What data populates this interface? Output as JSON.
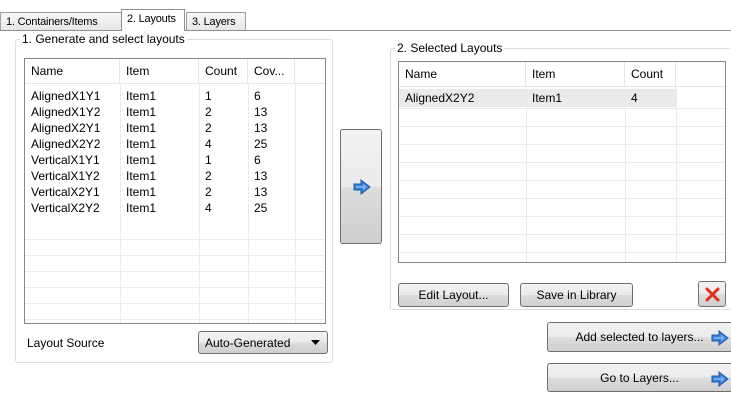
{
  "tabs": [
    {
      "label": "1. Containers/Items"
    },
    {
      "label": "2. Layouts"
    },
    {
      "label": "3. Layers"
    }
  ],
  "generate_group": {
    "title": "1. Generate and select layouts",
    "columns": [
      "Name",
      "Item",
      "Count",
      "Cov..."
    ],
    "rows": [
      [
        "AlignedX1Y1",
        "Item1",
        "1",
        "6"
      ],
      [
        "AlignedX1Y2",
        "Item1",
        "2",
        "13"
      ],
      [
        "AlignedX2Y1",
        "Item1",
        "2",
        "13"
      ],
      [
        "AlignedX2Y2",
        "Item1",
        "4",
        "25"
      ],
      [
        "VerticalX1Y1",
        "Item1",
        "1",
        "6"
      ],
      [
        "VerticalX1Y2",
        "Item1",
        "2",
        "13"
      ],
      [
        "VerticalX2Y1",
        "Item1",
        "2",
        "13"
      ],
      [
        "VerticalX2Y2",
        "Item1",
        "4",
        "25"
      ]
    ],
    "layout_source_label": "Layout Source",
    "layout_source_value": "Auto-Generated"
  },
  "selected_group": {
    "title": "2. Selected Layouts",
    "columns": [
      "Name",
      "Item",
      "Count"
    ],
    "rows": [
      [
        "AlignedX2Y2",
        "Item1",
        "4"
      ]
    ],
    "edit_layout_label": "Edit Layout...",
    "save_library_label": "Save in Library"
  },
  "buttons": {
    "add_selected_label": "Add selected to layers...",
    "go_to_layers_label": "Go to Layers..."
  },
  "colors": {
    "arrow_blue": "#3a7fd5",
    "delete_red": "#e0301e",
    "selected_row": "#eaeaea"
  }
}
